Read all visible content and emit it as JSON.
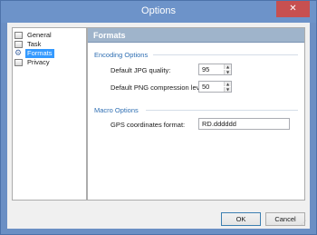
{
  "window": {
    "title": "Options",
    "close_glyph": "✕"
  },
  "tree": {
    "items": [
      {
        "label": "General",
        "icon": "checkbox-icon",
        "selected": false
      },
      {
        "label": "Task",
        "icon": "checkbox-icon",
        "selected": false
      },
      {
        "label": "Formats",
        "icon": "gear-icon",
        "selected": true
      },
      {
        "label": "Privacy",
        "icon": "checkbox-icon",
        "selected": false
      }
    ]
  },
  "panel": {
    "title": "Formats",
    "encoding": {
      "group_title": "Encoding Options",
      "jpg_label": "Default JPG quality:",
      "jpg_value": "95",
      "png_label": "Default PNG compression level:",
      "png_value": "50"
    },
    "macro": {
      "group_title": "Macro Options",
      "gps_label": "GPS coordinates format:",
      "gps_value": "RD.dddddd"
    }
  },
  "buttons": {
    "ok": "OK",
    "cancel": "Cancel"
  },
  "colors": {
    "title_bar": "#6d93c9",
    "close_button": "#c75050",
    "selection": "#3399ff",
    "group_title": "#2f6fb3",
    "panel_header": "#9fb4cb"
  }
}
